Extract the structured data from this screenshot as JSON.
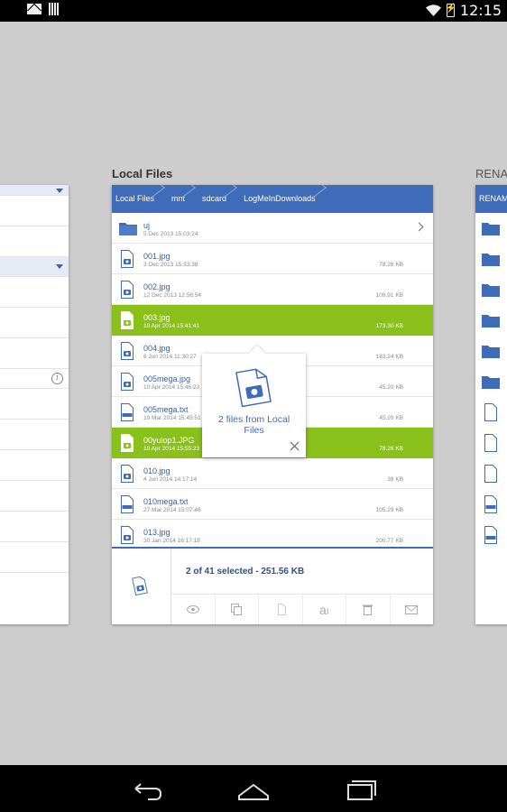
{
  "status_bar": {
    "time": "12:15"
  },
  "panels": {
    "main_title": "Local Files",
    "right_title": "RENAM",
    "right_header": "RENAM"
  },
  "breadcrumb": [
    "Local Files",
    "mnt",
    "sdcard",
    "LogMeInDownloads"
  ],
  "files": [
    {
      "name": "uj",
      "date": "5 Dec 2013 15:03:24",
      "size": "",
      "type": "folder",
      "selected": false
    },
    {
      "name": "001.jpg",
      "date": "3 Dec 2013 15:33:38",
      "size": "78.26 KB",
      "type": "image",
      "selected": false
    },
    {
      "name": "002.jpg",
      "date": "12 Dec 2013 12:56:54",
      "size": "109.91 KB",
      "type": "image",
      "selected": false
    },
    {
      "name": "003.jpg",
      "date": "10 Apr 2014 15:41:41",
      "size": "173.30 KB",
      "type": "image",
      "selected": true
    },
    {
      "name": "004.jpg",
      "date": "6 Jun 2014 11:30:27",
      "size": "183.24 KB",
      "type": "image",
      "selected": false
    },
    {
      "name": "005mega.jpg",
      "date": "10 Apr 2014 15:46:23",
      "size": "45.20 KB",
      "type": "image",
      "selected": false
    },
    {
      "name": "005mega.txt",
      "date": "19 Mar 2014 15:45:51",
      "size": "45.20 KB",
      "type": "text",
      "selected": false
    },
    {
      "name": "00yuiop1.JPG",
      "date": "10 Apr 2014 15:55:23",
      "size": "78.26 KB",
      "type": "image",
      "selected": true
    },
    {
      "name": "010.jpg",
      "date": "4 Jun 2014 14:17:14",
      "size": "38 KB",
      "type": "image",
      "selected": false
    },
    {
      "name": "010mega.txt",
      "date": "27 Mar 2014 15:07:46",
      "size": "105.29 KB",
      "type": "text",
      "selected": false
    },
    {
      "name": "013.jpg",
      "date": "30 Jan 2014 16:17:18",
      "size": "200.77 KB",
      "type": "image",
      "selected": false
    }
  ],
  "popup": {
    "text": "2 files from Local Files"
  },
  "selection": {
    "summary": "2 of 41 selected - 251.56 KB"
  },
  "actions": [
    {
      "name": "view",
      "icon": "eye-icon"
    },
    {
      "name": "copy",
      "icon": "copy-icon"
    },
    {
      "name": "cut",
      "icon": "cut-icon"
    },
    {
      "name": "rename",
      "icon": "rename-icon",
      "label": "a"
    },
    {
      "name": "delete",
      "icon": "trash-icon"
    },
    {
      "name": "email",
      "icon": "mail-icon"
    }
  ],
  "colors": {
    "accent": "#3f6cb8",
    "selected": "#8ac01a"
  }
}
